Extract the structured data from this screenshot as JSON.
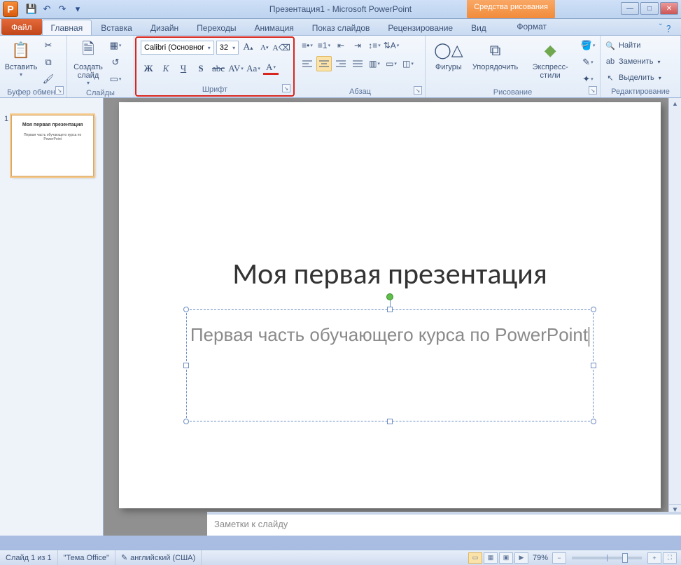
{
  "titlebar": {
    "app_letter": "P",
    "title": "Презентация1 - Microsoft PowerPoint",
    "drawing_tools": "Средства рисования"
  },
  "tabs": {
    "file": "Файл",
    "items": [
      "Главная",
      "Вставка",
      "Дизайн",
      "Переходы",
      "Анимация",
      "Показ слайдов",
      "Рецензирование",
      "Вид"
    ],
    "active_index": 0,
    "format": "Формат"
  },
  "ribbon": {
    "clipboard": {
      "paste": "Вставить",
      "label": "Буфер обмена"
    },
    "slides": {
      "new_slide": "Создать\nслайд",
      "label": "Слайды"
    },
    "font": {
      "name": "Calibri (Основног",
      "size": "32",
      "label": "Шрифт",
      "bold": "Ж",
      "italic": "К",
      "underline": "Ч",
      "shadow": "S",
      "strike": "abc",
      "spacing": "AV",
      "case": "Aa",
      "grow": "A",
      "shrink": "A",
      "clear": "⌫"
    },
    "paragraph": {
      "label": "Абзац"
    },
    "drawing": {
      "shapes": "Фигуры",
      "arrange": "Упорядочить",
      "styles": "Экспресс-стили",
      "label": "Рисование"
    },
    "editing": {
      "find": "Найти",
      "replace": "Заменить",
      "select": "Выделить",
      "label": "Редактирование"
    }
  },
  "thumbnail": {
    "number": "1",
    "title": "Моя первая презентация",
    "subtitle": "Первая часть обучающего курса по PowerPoint"
  },
  "slide": {
    "title": "Моя первая презентация",
    "subtitle": "Первая часть обучающего курса по PowerPoint"
  },
  "notes": {
    "placeholder": "Заметки к слайду"
  },
  "status": {
    "slide_pos": "Слайд 1 из 1",
    "theme": "\"Тема Office\"",
    "language": "английский (США)",
    "zoom": "79%"
  }
}
